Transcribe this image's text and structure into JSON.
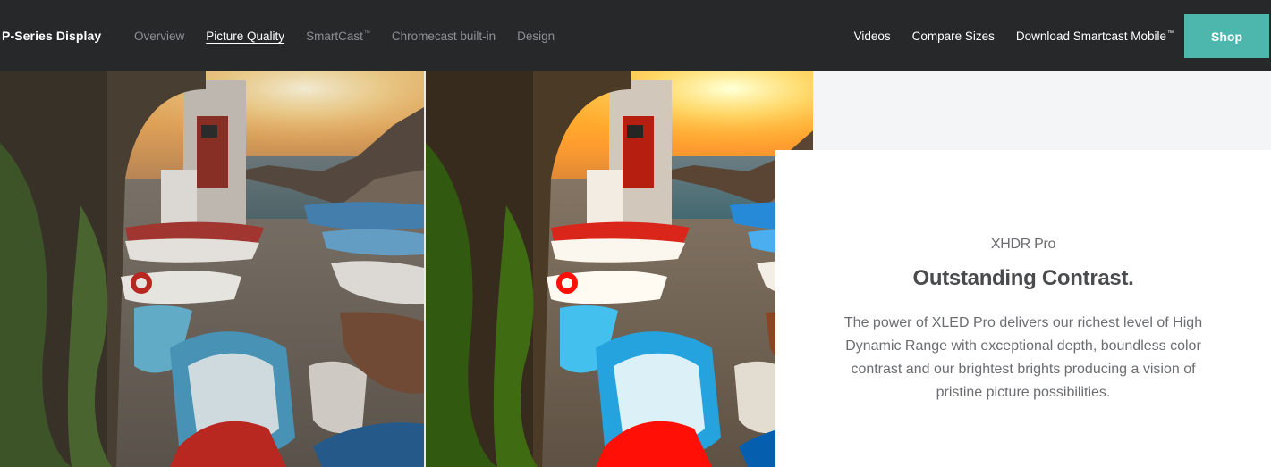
{
  "nav": {
    "brand": "P-Series Display",
    "left_items": [
      {
        "label": "Overview",
        "active": false
      },
      {
        "label": "Picture Quality",
        "active": true
      },
      {
        "label": "SmartCast",
        "tm": "™",
        "active": false
      },
      {
        "label": "Chromecast built-in",
        "active": false
      },
      {
        "label": "Design",
        "active": false
      }
    ],
    "right_items": [
      {
        "label": "Videos"
      },
      {
        "label": "Compare Sizes"
      },
      {
        "label": "Download Smartcast Mobile",
        "tm": "™"
      }
    ],
    "shop_label": "Shop"
  },
  "feature": {
    "eyebrow": "XHDR Pro",
    "headline": "Outstanding Contrast.",
    "body": "The power of XLED Pro delivers our richest level of High Dynamic Range with exceptional depth, boundless color contrast and our brightest brights producing a vision of pristine picture possibilities."
  },
  "colors": {
    "nav_bg": "#27282a",
    "shop_bg": "#4eb7ad",
    "panel_bg": "#f4f5f6"
  }
}
